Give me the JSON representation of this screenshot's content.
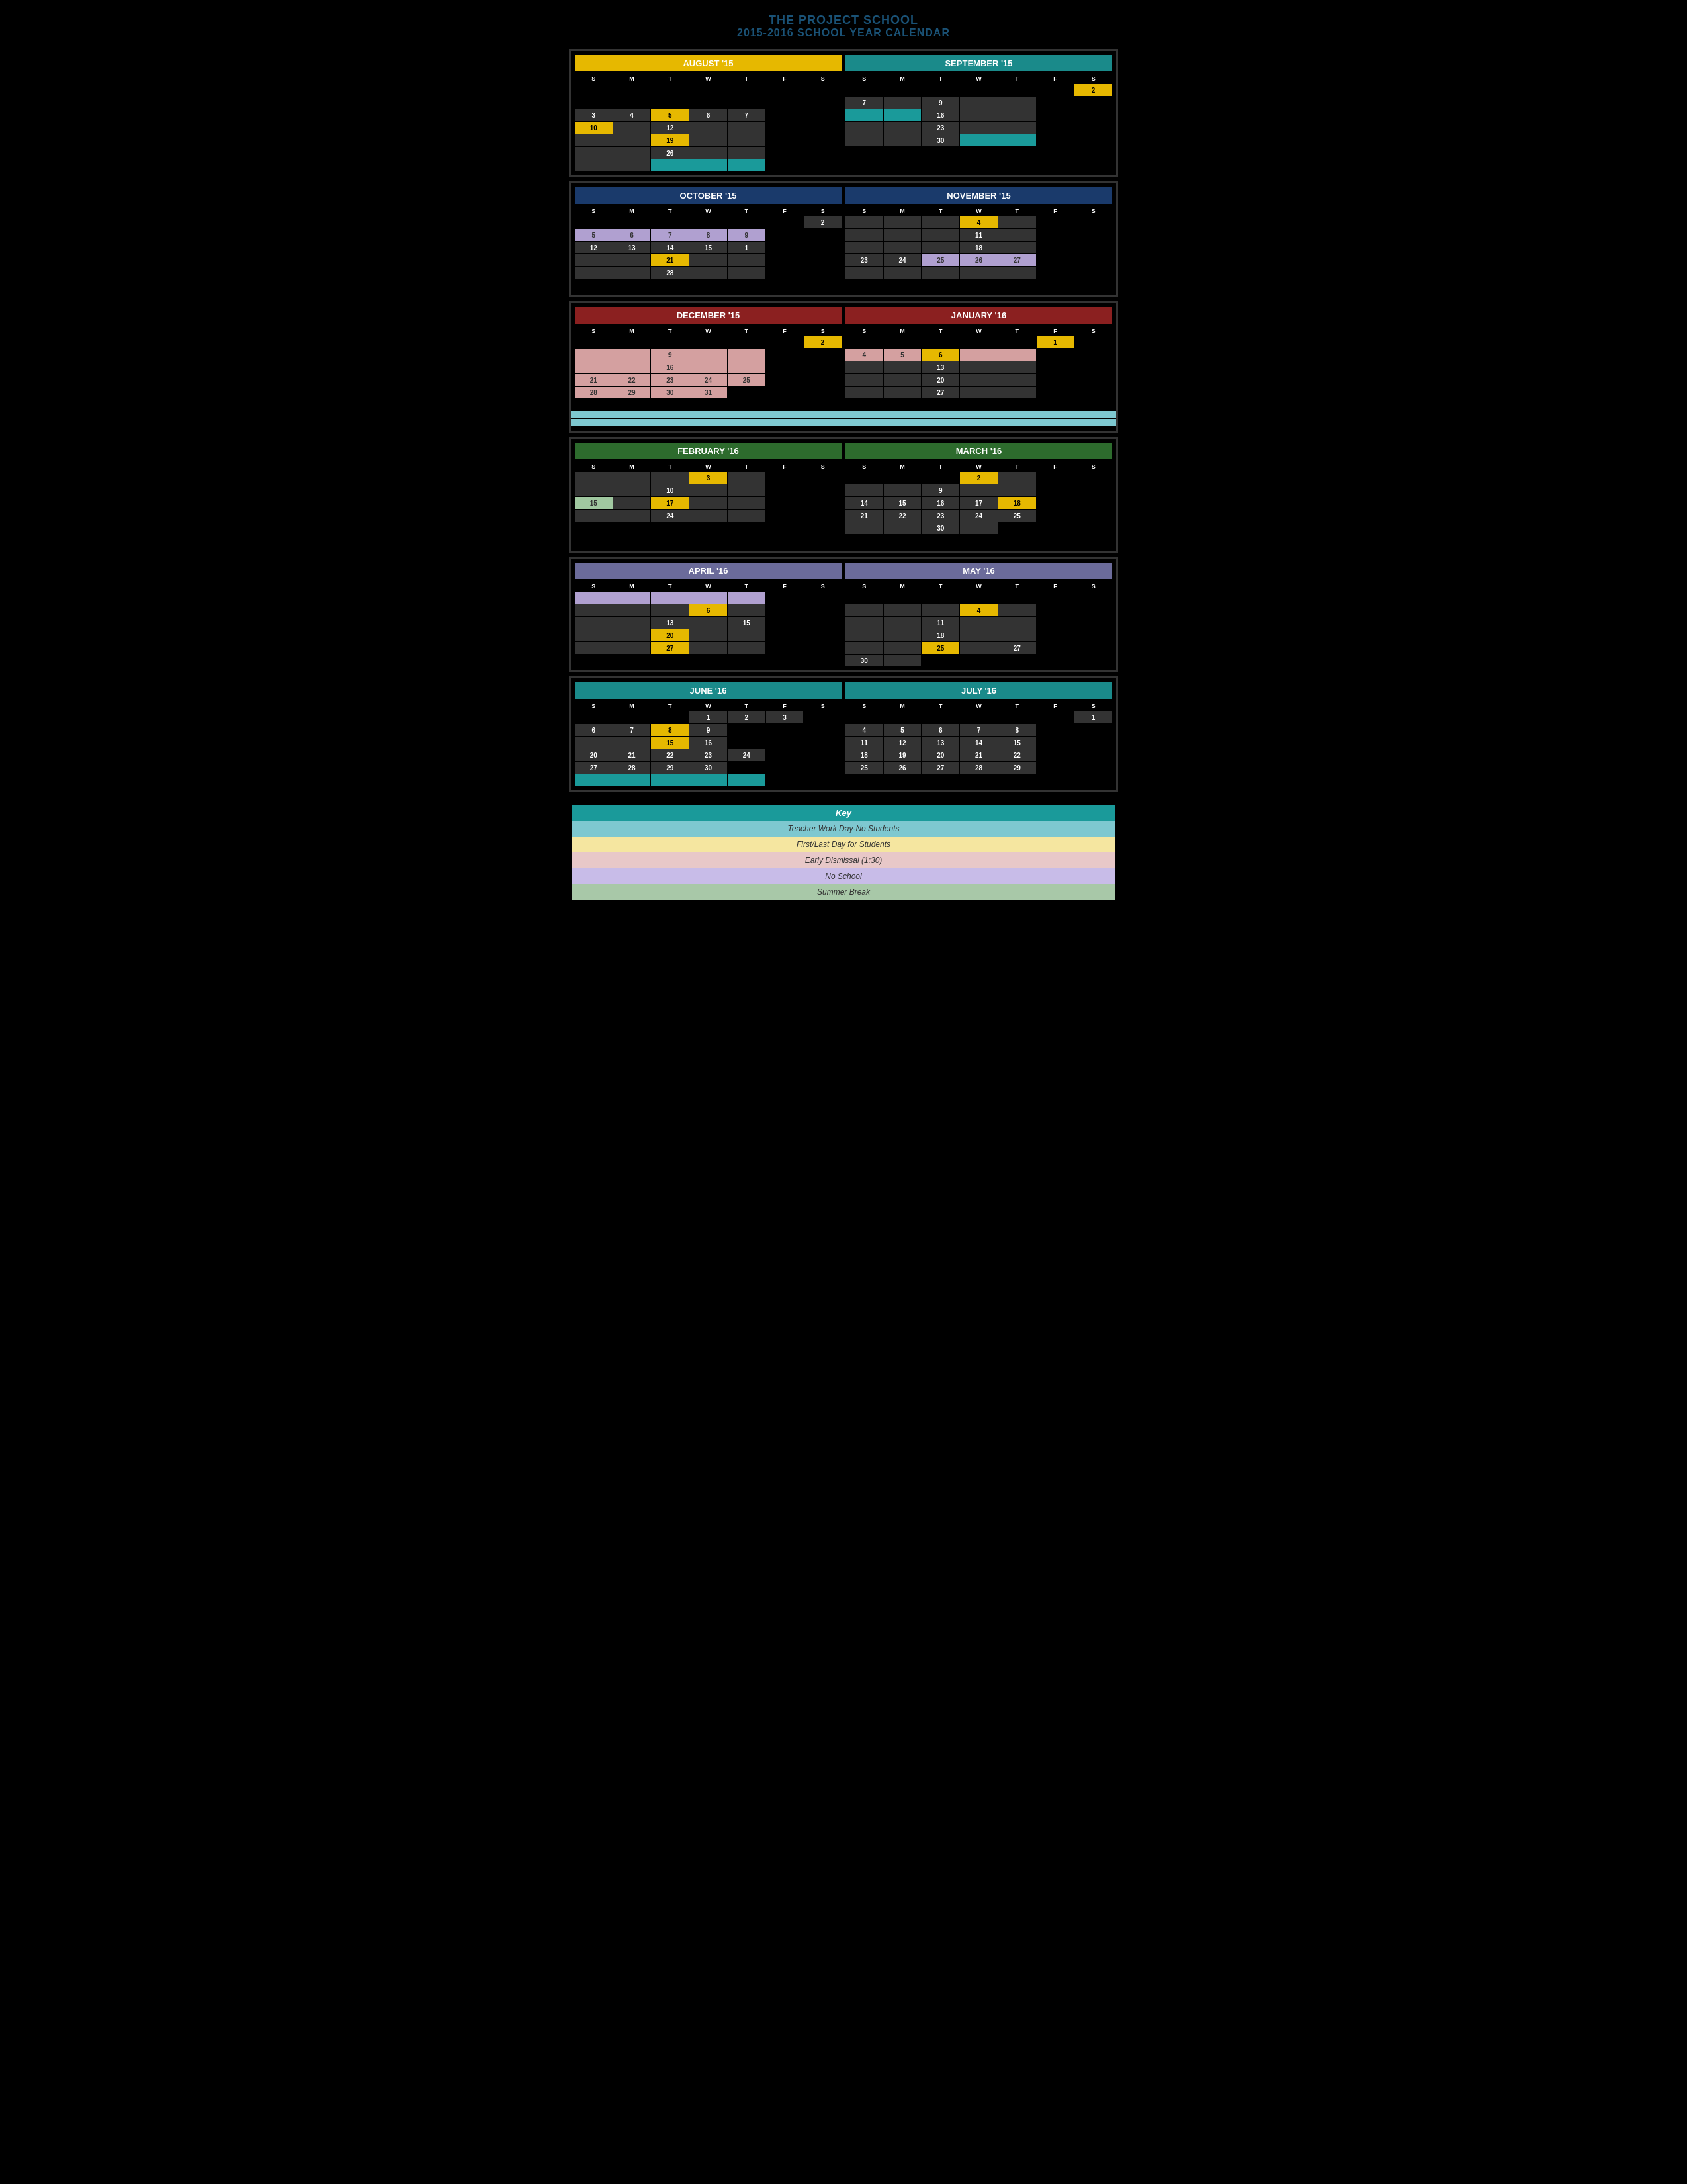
{
  "title": {
    "line1": "THE PROJECT SCHOOL",
    "line2": "2015-2016 SCHOOL YEAR CALENDAR"
  },
  "legend": {
    "header": "Key",
    "items": [
      "Teacher Work Day-No Students",
      "First/Last Day for Students",
      "Early Dismissal (1:30)",
      "No School",
      "Summer Break"
    ]
  }
}
